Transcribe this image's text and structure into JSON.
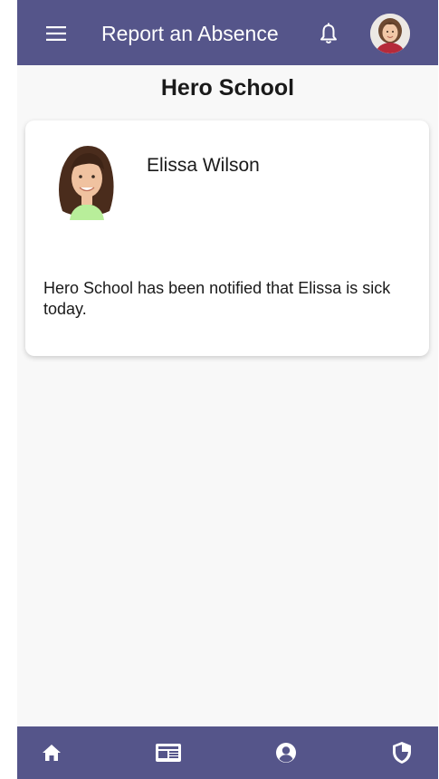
{
  "header": {
    "title": "Report an Absence",
    "menu_icon": "hamburger-menu-icon",
    "notification_icon": "bell-icon",
    "profile_avatar": "user-avatar"
  },
  "school": {
    "name": "Hero School"
  },
  "student_card": {
    "name": "Elissa Wilson",
    "photo": "student-photo",
    "message": "Hero School has been notified that Elissa is sick today."
  },
  "bottom_nav": {
    "items": [
      {
        "icon": "home-icon"
      },
      {
        "icon": "newspaper-icon"
      },
      {
        "icon": "user-circle-icon"
      },
      {
        "icon": "shield-icon"
      }
    ]
  },
  "colors": {
    "brand": "#55558a",
    "background": "#f8f8f8",
    "card": "#ffffff",
    "text": "#1a1a1a"
  }
}
